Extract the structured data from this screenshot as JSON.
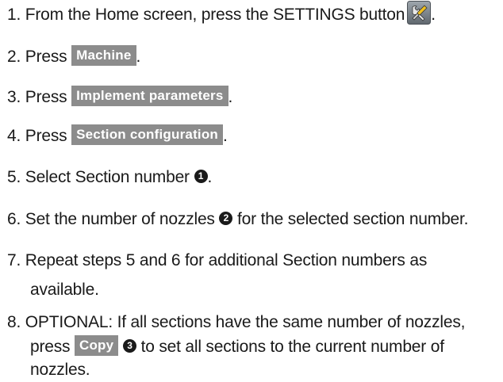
{
  "steps": [
    {
      "number": "1.",
      "before": "From the Home screen, press the SETTINGS button",
      "after": "."
    },
    {
      "number": "2.",
      "before": "Press",
      "button": "Machine",
      "after": "."
    },
    {
      "number": "3.",
      "before": "Press",
      "button": "Implement parameters",
      "after": "."
    },
    {
      "number": "4.",
      "before": "Press",
      "button": "Section configuration",
      "after": "."
    },
    {
      "number": "5.",
      "before": "Select Section number",
      "callout": "1",
      "after": "."
    },
    {
      "number": "6.",
      "before": "Set the number of nozzles",
      "callout": "2",
      "after": "for the selected section number."
    },
    {
      "number": "7.",
      "line1": "Repeat steps 5 and 6 for additional Section numbers as",
      "line2": "available."
    },
    {
      "number": "8.",
      "line1": "OPTIONAL: If all sections have the same number of nozzles,",
      "line2_before": "press",
      "button": "Copy",
      "callout": "3",
      "line2_after": "to set all sections to the current number of",
      "line3": "nozzles."
    }
  ],
  "icons": {
    "settings": "settings-tools-icon"
  },
  "colors": {
    "button_bg": "#8c8c8c",
    "button_text": "#ffffff",
    "text": "#1a1a1a"
  }
}
